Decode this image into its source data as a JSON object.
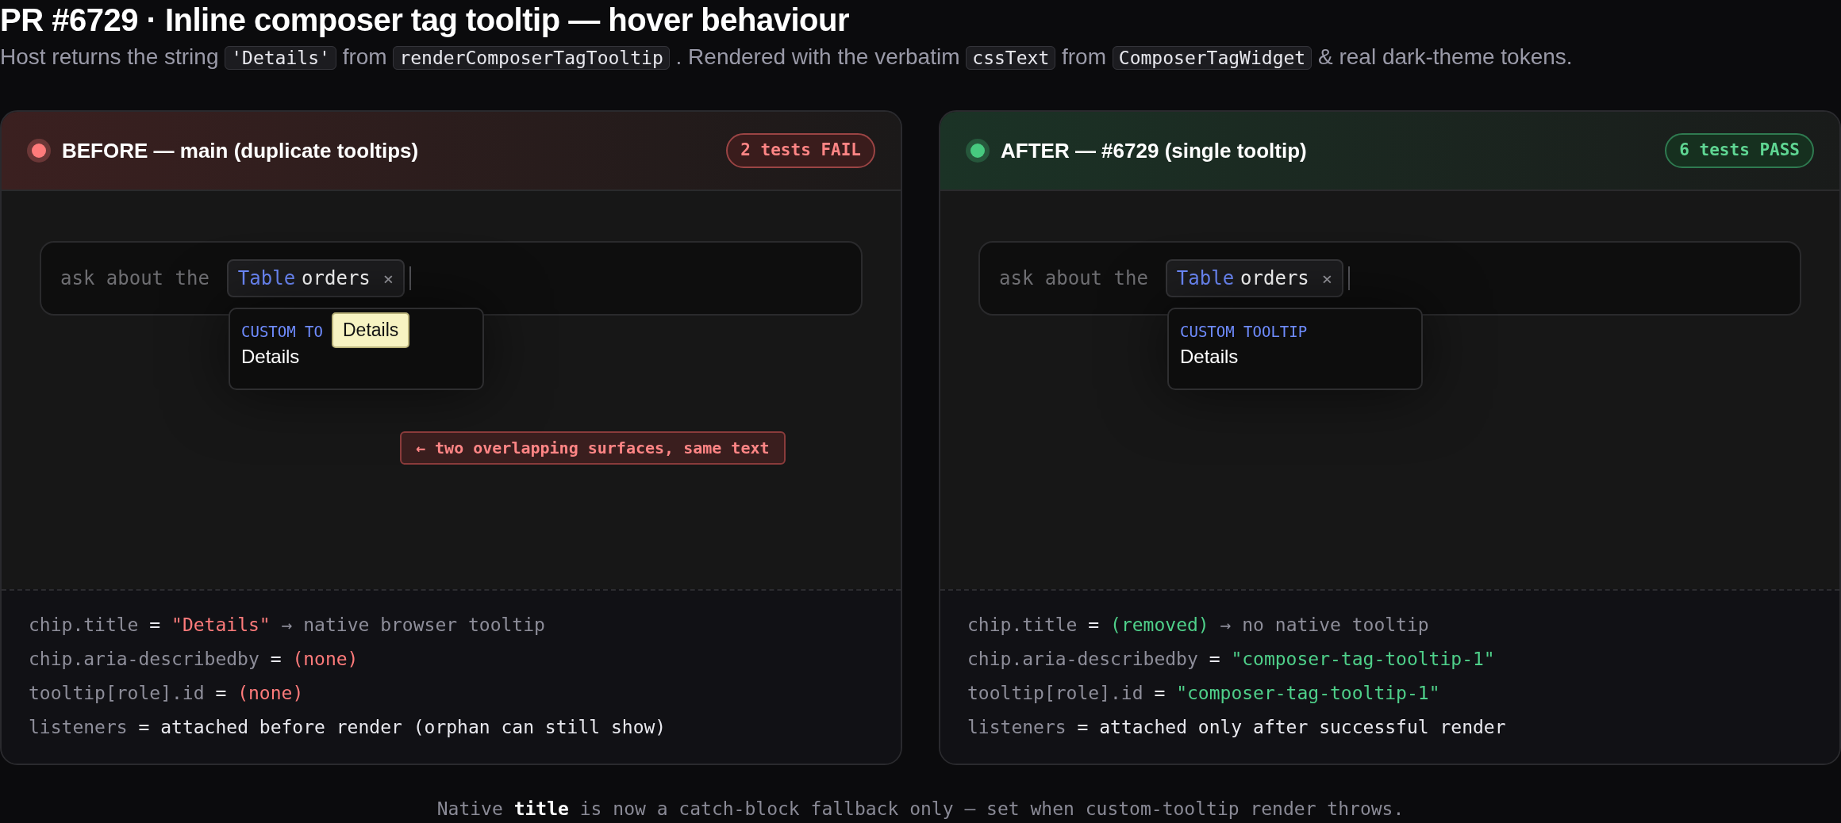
{
  "title": "PR #6729 · Inline composer tag tooltip — hover behaviour",
  "subtitle": [
    {
      "kind": "text",
      "text": "Host returns the string"
    },
    {
      "kind": "code",
      "text": "'Details'"
    },
    {
      "kind": "text",
      "text": "from"
    },
    {
      "kind": "code",
      "text": "renderComposerTagTooltip"
    },
    {
      "kind": "text",
      "text": ". Rendered with the verbatim"
    },
    {
      "kind": "code",
      "text": "cssText"
    },
    {
      "kind": "text",
      "text": "from"
    },
    {
      "kind": "code",
      "text": "ComposerTagWidget"
    },
    {
      "kind": "text",
      "text": "& real dark-theme tokens."
    }
  ],
  "panels": [
    {
      "passing": false,
      "title": "BEFORE — main (duplicate tooltips)",
      "badge": "2 tests FAIL",
      "composer": {
        "prefix": "ask about the",
        "chip": {
          "type": "Table",
          "name": "orders",
          "remove": "×"
        }
      },
      "custom_tooltip": {
        "label": "CUSTOM TO",
        "text": "Details"
      },
      "native_tooltip": {
        "text": "Details"
      },
      "annotation": "← two overlapping surfaces, same text",
      "facts": [
        [
          {
            "kind": "key",
            "text": "chip.title"
          },
          {
            "kind": "op",
            "text": "="
          },
          {
            "kind": "bad",
            "text": "\"Details\""
          },
          {
            "kind": "note",
            "text": "→ native browser tooltip"
          }
        ],
        [
          {
            "kind": "key",
            "text": "chip.aria-describedby"
          },
          {
            "kind": "op",
            "text": "="
          },
          {
            "kind": "bad",
            "text": "(none)"
          }
        ],
        [
          {
            "kind": "key",
            "text": "tooltip[role].id"
          },
          {
            "kind": "op",
            "text": "="
          },
          {
            "kind": "bad",
            "text": "(none)"
          }
        ],
        [
          {
            "kind": "key",
            "text": "listeners"
          },
          {
            "kind": "op",
            "text": "="
          },
          {
            "kind": "plain",
            "text": "attached before render (orphan can still show)"
          }
        ]
      ]
    },
    {
      "passing": true,
      "title": "AFTER — #6729 (single tooltip)",
      "badge": "6 tests PASS",
      "composer": {
        "prefix": "ask about the",
        "chip": {
          "type": "Table",
          "name": "orders",
          "remove": "×"
        }
      },
      "custom_tooltip": {
        "label": "CUSTOM TOOLTIP",
        "text": "Details"
      },
      "facts": [
        [
          {
            "kind": "key",
            "text": "chip.title"
          },
          {
            "kind": "op",
            "text": "="
          },
          {
            "kind": "good",
            "text": "(removed)"
          },
          {
            "kind": "note",
            "text": "→ no native tooltip"
          }
        ],
        [
          {
            "kind": "key",
            "text": "chip.aria-describedby"
          },
          {
            "kind": "op",
            "text": "="
          },
          {
            "kind": "good",
            "text": "\"composer-tag-tooltip-1\""
          }
        ],
        [
          {
            "kind": "key",
            "text": "tooltip[role].id"
          },
          {
            "kind": "op",
            "text": "="
          },
          {
            "kind": "good",
            "text": "\"composer-tag-tooltip-1\""
          }
        ],
        [
          {
            "kind": "key",
            "text": "listeners"
          },
          {
            "kind": "op",
            "text": "="
          },
          {
            "kind": "plain",
            "text": "attached only after successful render"
          }
        ]
      ]
    }
  ],
  "footer": [
    {
      "kind": "text",
      "text": "Native"
    },
    {
      "kind": "code",
      "text": "title"
    },
    {
      "kind": "text",
      "text": "is now a catch-block fallback only — set when custom-tooltip render throws."
    }
  ]
}
